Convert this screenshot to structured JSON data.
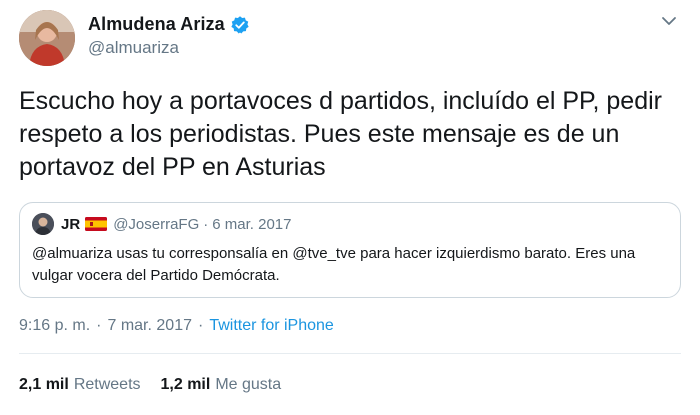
{
  "author": {
    "display_name": "Almudena Ariza",
    "handle": "@almuariza",
    "verified": true
  },
  "icons": {
    "avatar": "profile-photo",
    "verified": "verified-badge-icon",
    "menu": "chevron-down-icon",
    "flag": "spain-flag-icon"
  },
  "tweet": {
    "text": "Escucho hoy a portavoces d partidos, incluído el PP, pedir respeto a los periodistas. Pues este mensaje es de un portavoz del PP en Asturias"
  },
  "quoted": {
    "name": "JR",
    "handle": "@JoserraFG",
    "dot": "·",
    "date": "6 mar. 2017",
    "text": "@almuariza usas tu corresponsalía en @tve_tve para hacer izquierdismo barato. Eres una vulgar vocera del Partido Demócrata."
  },
  "meta": {
    "time": "9:16 p. m.",
    "dot1": "·",
    "date": "7 mar. 2017",
    "dot2": "·",
    "source": "Twitter for iPhone"
  },
  "stats": {
    "retweets_count": "2,1 mil",
    "retweets_label": "Retweets",
    "likes_count": "1,2 mil",
    "likes_label": "Me gusta"
  },
  "colors": {
    "accent": "#1da1f2",
    "link": "#1b95e0",
    "secondary_text": "#657786",
    "border": "#ccd6dd"
  }
}
